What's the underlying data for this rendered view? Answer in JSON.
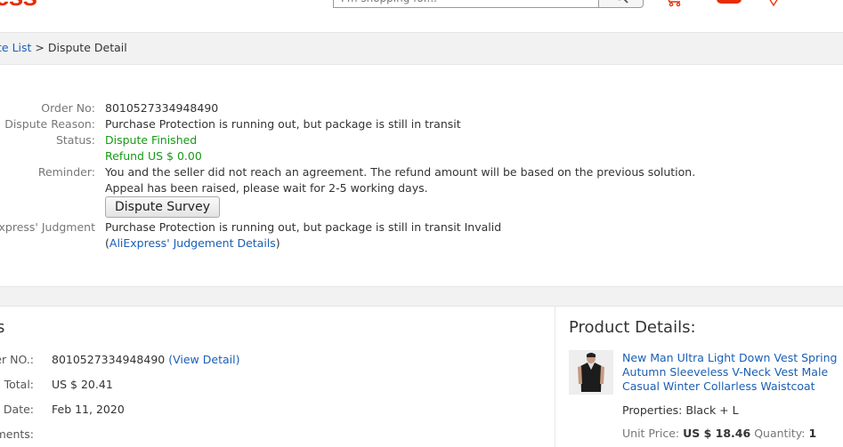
{
  "header": {
    "logo_text": "ess",
    "search_placeholder": "I'm shopping for...",
    "icons": [
      "search-icon",
      "cart-icon",
      "heart-icon"
    ]
  },
  "breadcrumb": {
    "parent_link": "te List",
    "separator": " > ",
    "current": "Dispute Detail"
  },
  "dispute": {
    "order_no_label": "Order No:",
    "order_no": "8010527334948490",
    "reason_label": "Dispute Reason:",
    "reason": "Purchase Protection is running out, but package is still in transit",
    "status_label": "Status:",
    "status": "Dispute Finished",
    "refund": "Refund US $ 0.00",
    "reminder_label": "Reminder:",
    "reminder_1": "You and the seller did not reach an agreement. The refund amount will be based on the previous solution.",
    "reminder_2": "Appeal has been raised, please wait for 2-5 working days.",
    "survey_button": "Dispute Survey",
    "judgment_label": "Express' Judgment",
    "judgment": "Purchase Protection is running out, but package is still in transit  Invalid",
    "judgment_link_open": "(",
    "judgment_link": "AliExpress' Judgement Details",
    "judgment_link_close": ")"
  },
  "order": {
    "section_title": "s",
    "order_no_label": "er NO.:",
    "order_no": "8010527334948490",
    "view_detail": "(View Detail)",
    "total_label": "Total:",
    "total": "US $ 20.41",
    "date_label": "r Date:",
    "date": "Feb 11, 2020",
    "comments_label": "ments:"
  },
  "product": {
    "title": "Product Details:",
    "name": "New Man Ultra Light Down Vest Spring Autumn Sleeveless V-Neck Vest Male Casual Winter Collarless Waistcoat",
    "properties_label": "Properties:",
    "properties": "Black + L",
    "unit_price_label": "Unit Price:",
    "unit_price": "US $ 18.46",
    "quantity_label": "Quantity:",
    "quantity": "1"
  },
  "colors": {
    "brand": "#e62e04",
    "link": "#1a5fb4",
    "status_green": "#159a15"
  }
}
